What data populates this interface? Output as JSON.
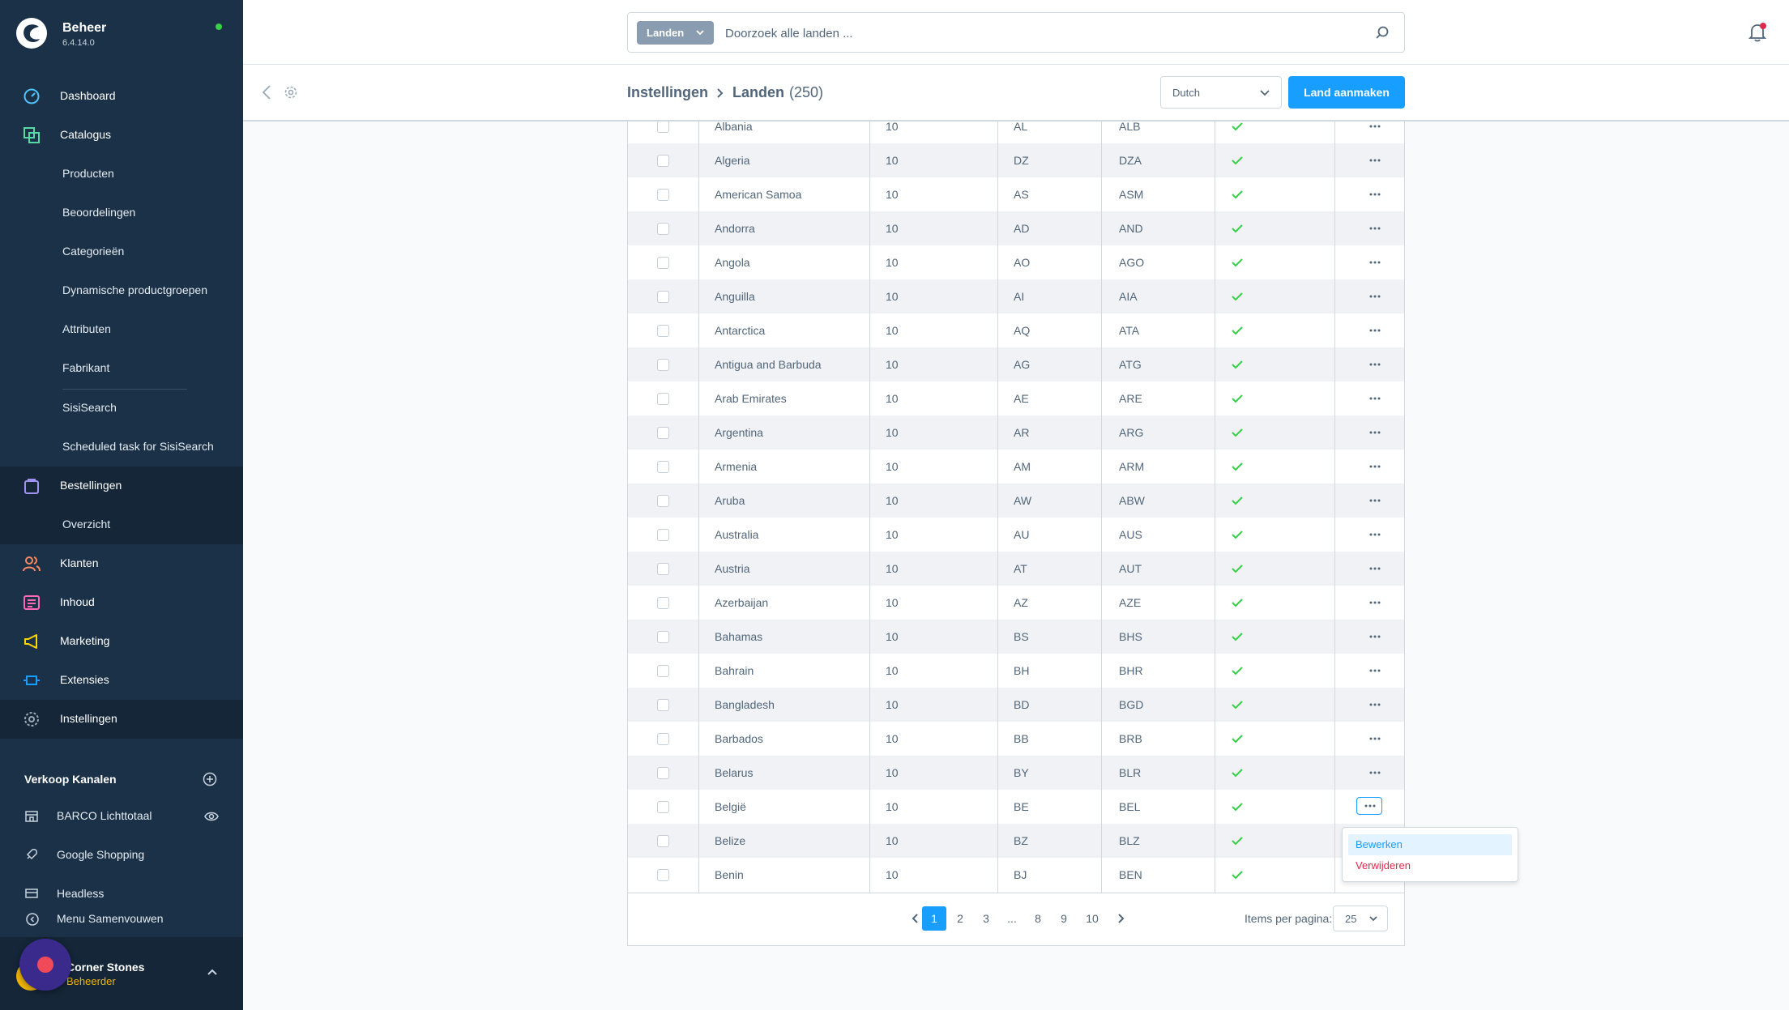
{
  "app": {
    "name": "Beheer",
    "version": "6.4.14.0",
    "status_color": "#37d046",
    "accent": "#189eff"
  },
  "sidebar": {
    "main": [
      {
        "label": "Dashboard",
        "icon": "dashboard-icon"
      },
      {
        "label": "Catalogus",
        "icon": "catalog-icon"
      },
      {
        "label": "Bestellingen",
        "icon": "orders-icon"
      },
      {
        "label": "Klanten",
        "icon": "customers-icon"
      },
      {
        "label": "Inhoud",
        "icon": "content-icon"
      },
      {
        "label": "Marketing",
        "icon": "marketing-icon"
      },
      {
        "label": "Extensies",
        "icon": "extensions-icon"
      },
      {
        "label": "Instellingen",
        "icon": "settings-icon"
      }
    ],
    "catalog_sub": [
      "Producten",
      "Beoordelingen",
      "Categorieën",
      "Dynamische productgroepen",
      "Attributen",
      "Fabrikant",
      "SisiSearch",
      "Scheduled task for SisiSearch"
    ],
    "orders_sub": [
      "Overzicht"
    ],
    "sales_channels_title": "Verkoop Kanalen",
    "sales_channels": [
      {
        "label": "BARCO Lichttotaal",
        "icon": "storefront-icon"
      },
      {
        "label": "Google Shopping",
        "icon": "rocket-icon"
      },
      {
        "label": "Headless",
        "icon": "headless-icon"
      }
    ],
    "collapse_label": "Menu Samenvouwen",
    "user": {
      "name": "Corner Stones",
      "role": "Beheerder"
    }
  },
  "search": {
    "type_label": "Landen",
    "placeholder": "Doorzoek alle landen ..."
  },
  "smartbar": {
    "crumb_parent": "Instellingen",
    "crumb_current": "Landen",
    "count": "(250)",
    "language": "Dutch",
    "create_label": "Land aanmaken"
  },
  "rows": [
    {
      "name": "Albania",
      "position": "10",
      "iso": "AL",
      "iso3": "ALB",
      "active": true
    },
    {
      "name": "Algeria",
      "position": "10",
      "iso": "DZ",
      "iso3": "DZA",
      "active": true
    },
    {
      "name": "American Samoa",
      "position": "10",
      "iso": "AS",
      "iso3": "ASM",
      "active": true
    },
    {
      "name": "Andorra",
      "position": "10",
      "iso": "AD",
      "iso3": "AND",
      "active": true
    },
    {
      "name": "Angola",
      "position": "10",
      "iso": "AO",
      "iso3": "AGO",
      "active": true
    },
    {
      "name": "Anguilla",
      "position": "10",
      "iso": "AI",
      "iso3": "AIA",
      "active": true
    },
    {
      "name": "Antarctica",
      "position": "10",
      "iso": "AQ",
      "iso3": "ATA",
      "active": true
    },
    {
      "name": "Antigua and Barbuda",
      "position": "10",
      "iso": "AG",
      "iso3": "ATG",
      "active": true
    },
    {
      "name": "Arab Emirates",
      "position": "10",
      "iso": "AE",
      "iso3": "ARE",
      "active": true
    },
    {
      "name": "Argentina",
      "position": "10",
      "iso": "AR",
      "iso3": "ARG",
      "active": true
    },
    {
      "name": "Armenia",
      "position": "10",
      "iso": "AM",
      "iso3": "ARM",
      "active": true
    },
    {
      "name": "Aruba",
      "position": "10",
      "iso": "AW",
      "iso3": "ABW",
      "active": true
    },
    {
      "name": "Australia",
      "position": "10",
      "iso": "AU",
      "iso3": "AUS",
      "active": true
    },
    {
      "name": "Austria",
      "position": "10",
      "iso": "AT",
      "iso3": "AUT",
      "active": true
    },
    {
      "name": "Azerbaijan",
      "position": "10",
      "iso": "AZ",
      "iso3": "AZE",
      "active": true
    },
    {
      "name": "Bahamas",
      "position": "10",
      "iso": "BS",
      "iso3": "BHS",
      "active": true
    },
    {
      "name": "Bahrain",
      "position": "10",
      "iso": "BH",
      "iso3": "BHR",
      "active": true
    },
    {
      "name": "Bangladesh",
      "position": "10",
      "iso": "BD",
      "iso3": "BGD",
      "active": true
    },
    {
      "name": "Barbados",
      "position": "10",
      "iso": "BB",
      "iso3": "BRB",
      "active": true
    },
    {
      "name": "Belarus",
      "position": "10",
      "iso": "BY",
      "iso3": "BLR",
      "active": true
    },
    {
      "name": "België",
      "position": "10",
      "iso": "BE",
      "iso3": "BEL",
      "active": true
    },
    {
      "name": "Belize",
      "position": "10",
      "iso": "BZ",
      "iso3": "BLZ",
      "active": true
    },
    {
      "name": "Benin",
      "position": "10",
      "iso": "BJ",
      "iso3": "BEN",
      "active": true
    }
  ],
  "open_menu_row": "België",
  "context_menu": {
    "edit": "Bewerken",
    "delete": "Verwijderen"
  },
  "pagination": {
    "pages": [
      "1",
      "2",
      "3",
      "...",
      "8",
      "9",
      "10"
    ],
    "current": "1",
    "items_per_page_label": "Items per pagina:",
    "items_per_page": "25"
  }
}
